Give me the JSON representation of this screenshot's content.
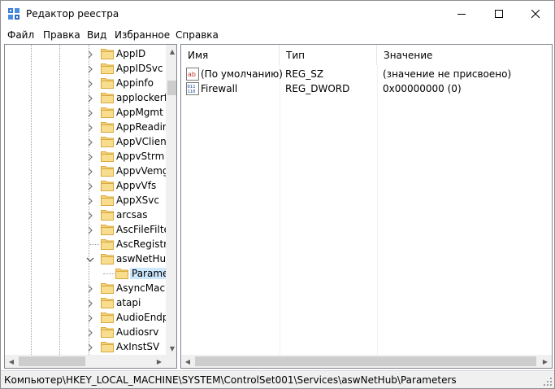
{
  "window": {
    "title": "Редактор реестра"
  },
  "menu": {
    "items": [
      "Файл",
      "Правка",
      "Вид",
      "Избранное",
      "Справка"
    ]
  },
  "tree": {
    "items": [
      {
        "label": "AppID",
        "expander": "collapsed"
      },
      {
        "label": "AppIDSvc",
        "expander": "collapsed"
      },
      {
        "label": "Appinfo",
        "expander": "collapsed"
      },
      {
        "label": "applockerf",
        "expander": "collapsed"
      },
      {
        "label": "AppMgmt",
        "expander": "collapsed"
      },
      {
        "label": "AppReadin",
        "expander": "collapsed"
      },
      {
        "label": "AppVClien",
        "expander": "collapsed"
      },
      {
        "label": "AppvStrm",
        "expander": "collapsed"
      },
      {
        "label": "AppvVemg",
        "expander": "collapsed"
      },
      {
        "label": "AppvVfs",
        "expander": "collapsed"
      },
      {
        "label": "AppXSvc",
        "expander": "collapsed"
      },
      {
        "label": "arcsas",
        "expander": "collapsed"
      },
      {
        "label": "AscFileFilte",
        "expander": "collapsed"
      },
      {
        "label": "AscRegistry",
        "expander": "none"
      },
      {
        "label": "aswNetHul",
        "expander": "expanded"
      },
      {
        "label": "Parame",
        "expander": "child",
        "selected": true
      },
      {
        "label": "AsyncMac",
        "expander": "collapsed"
      },
      {
        "label": "atapi",
        "expander": "collapsed"
      },
      {
        "label": "AudioEndp",
        "expander": "collapsed"
      },
      {
        "label": "Audiosrv",
        "expander": "collapsed"
      },
      {
        "label": "AxInstSV",
        "expander": "collapsed"
      }
    ]
  },
  "list": {
    "columns": [
      "Имя",
      "Тип",
      "Значение"
    ],
    "rows": [
      {
        "icon": "string-value-icon",
        "name": "(По умолчанию)",
        "type": "REG_SZ",
        "value": "(значение не присвоено)"
      },
      {
        "icon": "dword-value-icon",
        "name": "Firewall",
        "type": "REG_DWORD",
        "value": "0x00000000 (0)"
      }
    ]
  },
  "status": {
    "path": "Компьютер\\HKEY_LOCAL_MACHINE\\SYSTEM\\ControlSet001\\Services\\aswNetHub\\Parameters"
  },
  "colors": {
    "selection": "#cce8ff",
    "folder": "#f4d27a",
    "scrollbar": "#f0f0f0"
  }
}
